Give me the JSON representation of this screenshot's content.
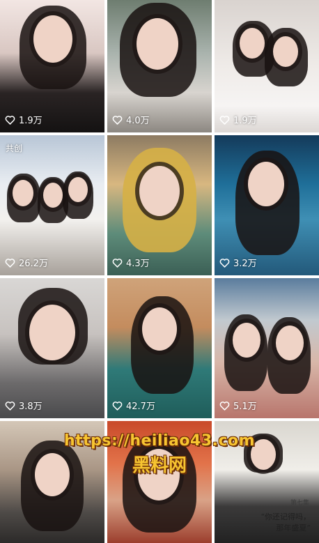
{
  "grid": {
    "items": [
      {
        "likes": "1.9万",
        "badge": ""
      },
      {
        "likes": "4.0万",
        "badge": ""
      },
      {
        "likes": "1.9万",
        "badge": ""
      },
      {
        "likes": "26.2万",
        "badge": "共创"
      },
      {
        "likes": "4.3万",
        "badge": ""
      },
      {
        "likes": "3.2万",
        "badge": ""
      },
      {
        "likes": "3.8万",
        "badge": ""
      },
      {
        "likes": "42.7万",
        "badge": ""
      },
      {
        "likes": "5.1万",
        "badge": ""
      },
      {
        "likes": "",
        "badge": ""
      },
      {
        "likes": "",
        "badge": ""
      },
      {
        "likes": "",
        "badge": ""
      }
    ]
  },
  "watermark": {
    "url": "https://heiliao43.com",
    "name": "黑料网"
  },
  "tile_captions": {
    "quote": "“你还记得吗，",
    "quote2": "那年盛夏”",
    "chapter": "第七集"
  },
  "icons": {
    "heart": "heart-outline-icon"
  },
  "colors": {
    "watermark_yellow": "#f7c531",
    "watermark_outline": "#6b2e08",
    "like_text": "#ffffff"
  }
}
